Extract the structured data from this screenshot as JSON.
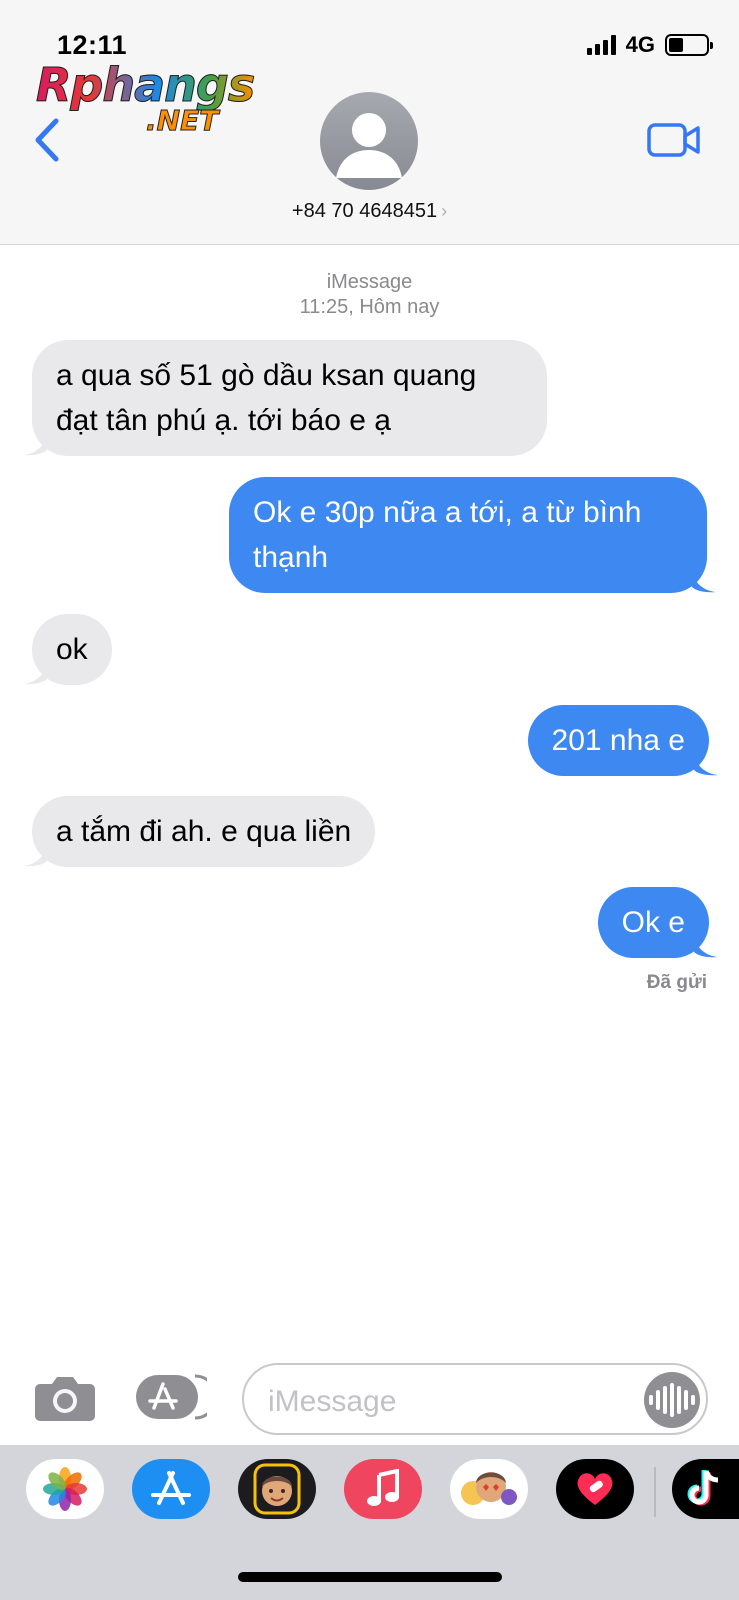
{
  "status_bar": {
    "time": "12:11",
    "network": "4G",
    "battery_level": 0.4
  },
  "watermark": {
    "line1": "Rphangs",
    "line2": ".NET"
  },
  "header": {
    "contact_number": "+84 70 4648451",
    "detail_chevron": "›"
  },
  "thread": {
    "service": "iMessage",
    "timestamp": "11:25, Hôm nay",
    "messages": [
      {
        "dir": "in",
        "lines": [
          "a qua số 51 gò dầu ksan quang",
          "đạt tân phú ạ. tới báo e ạ"
        ]
      },
      {
        "dir": "out",
        "lines": [
          "Ok e 30p nữa a tới, a từ bình",
          "thạnh"
        ]
      },
      {
        "dir": "in",
        "lines": [
          "ok"
        ]
      },
      {
        "dir": "out",
        "lines": [
          "201 nha e"
        ]
      },
      {
        "dir": "in",
        "lines": [
          "a tắm đi ah. e qua liền"
        ]
      },
      {
        "dir": "out",
        "lines": [
          "Ok e"
        ]
      }
    ],
    "delivery_status": "Đã gửi"
  },
  "composer": {
    "placeholder": "iMessage"
  },
  "app_drawer": {
    "apps": [
      "photos-icon",
      "app-store-icon",
      "memoji-icon",
      "music-icon",
      "animoji-stickers-icon",
      "digital-touch-icon",
      "tiktok-icon"
    ]
  },
  "colors": {
    "sent_bubble": "#3d88f1",
    "received_bubble": "#e9e9eb",
    "accent": "#3478f6"
  }
}
